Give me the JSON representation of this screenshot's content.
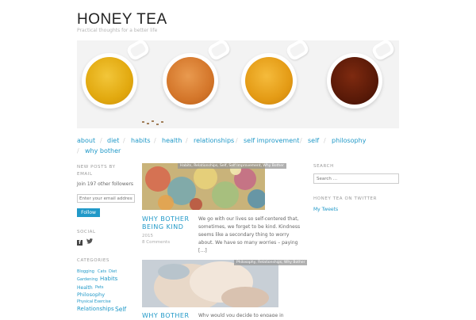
{
  "site": {
    "title": "HONEY TEA",
    "tagline": "Practical thoughts for a better life"
  },
  "colors": {
    "accent": "#2199c8",
    "tea_1": "#e2a90f",
    "tea_2": "#d4762a",
    "tea_3": "#e49b15",
    "tea_4": "#5a1a08"
  },
  "nav": {
    "items": [
      "about",
      "diet",
      "habits",
      "health",
      "relationships",
      "self improvement",
      "self",
      "philosophy",
      "why bother"
    ],
    "separator": "/"
  },
  "sidebar_left": {
    "new_posts_heading": "NEW POSTS BY EMAIL",
    "followers_text": "Join 197 other followers",
    "email_placeholder": "Enter your email address",
    "follow_button": "Follow",
    "social_heading": "SOCIAL",
    "social_icons": [
      "facebook-icon",
      "twitter-icon"
    ],
    "categories_heading": "CATEGORIES",
    "tags": [
      "Blogging",
      "Cats",
      "Diet",
      "Gardening",
      "Habits",
      "Health",
      "Pets",
      "Philosophy",
      "Physical Exercise",
      "Relationships",
      "Self"
    ]
  },
  "posts": [
    {
      "categories": "Habits, Relationships, Self, Self Improvement, Why Bother",
      "title": "WHY BOTHER BEING KIND",
      "year": "2015",
      "comments": "8 Comments",
      "excerpt": "We go with our lives so self-centered that, sometimes, we forget to be kind. Kindness seems like a secondary thing to worry about. We have so many worries – paying […]"
    },
    {
      "categories": "Philosophy, Relationships, Why Bother",
      "title": "WHY BOTHER",
      "excerpt": "Why would you decide to engage in something"
    }
  ],
  "sidebar_right": {
    "search_heading": "SEARCH",
    "search_placeholder": "Search …",
    "twitter_heading": "HONEY TEA ON TWITTER",
    "tweets_link": "My Tweets"
  }
}
